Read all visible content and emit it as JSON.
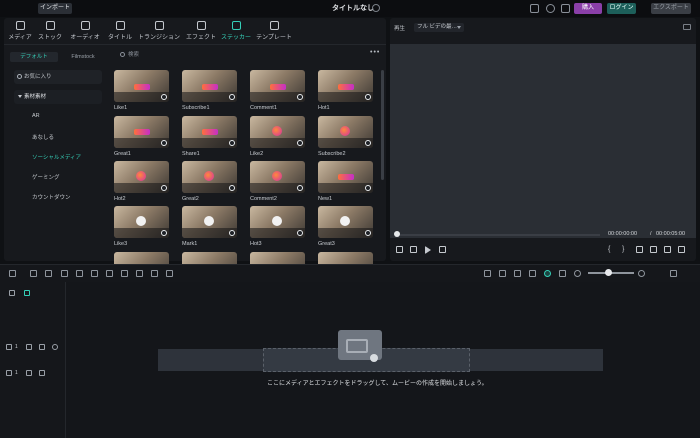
{
  "topbar": {
    "import_label": "インポート",
    "project_title": "タイトルなし",
    "buy_label": "購入",
    "login_label": "ログイン",
    "export_label": "エクスポート"
  },
  "media_tabs": [
    {
      "label": "メディア",
      "icon": "media-icon"
    },
    {
      "label": "ストック",
      "icon": "stock-icon"
    },
    {
      "label": "オーディオ",
      "icon": "music-icon"
    },
    {
      "label": "タイトル",
      "icon": "text-icon"
    },
    {
      "label": "トランジション",
      "icon": "transition-icon"
    },
    {
      "label": "エフェクト",
      "icon": "effect-icon"
    },
    {
      "label": "ステッカー",
      "icon": "sticker-icon",
      "active": true
    },
    {
      "label": "テンプレート",
      "icon": "template-icon"
    }
  ],
  "subtabs": {
    "default": "デフォルト",
    "other": "Filmstock"
  },
  "sidebar": {
    "favorites": "お気に入り",
    "category_header": "素材素材",
    "items": [
      "AR",
      "あなしる",
      "ソーシャルメディア",
      "ゲーミング",
      "カウントダウン"
    ]
  },
  "search": {
    "placeholder": "検索"
  },
  "stickers": [
    "Like1",
    "Subscribe1",
    "Comment1",
    "Hot1",
    "Great1",
    "Share1",
    "Like2",
    "Subscribe2",
    "Hot2",
    "Great2",
    "Comment2",
    "New1",
    "Like3",
    "Mark1",
    "Hot3",
    "Great3"
  ],
  "preview": {
    "label": "再生",
    "quality": "フル ビデの最…",
    "current_time": "00:00:00:00",
    "separator": "/",
    "total_time": "00:00:05:00"
  },
  "timeline": {
    "video_track": "1",
    "audio_track": "1",
    "drop_hint": "ここにメディアとエフェクトをドラッグして、ムービーの作成を開始しましょう。"
  },
  "colors": {
    "accent": "#35d0b8",
    "buy": "#8a3fa8",
    "login": "#1d5f5a"
  }
}
